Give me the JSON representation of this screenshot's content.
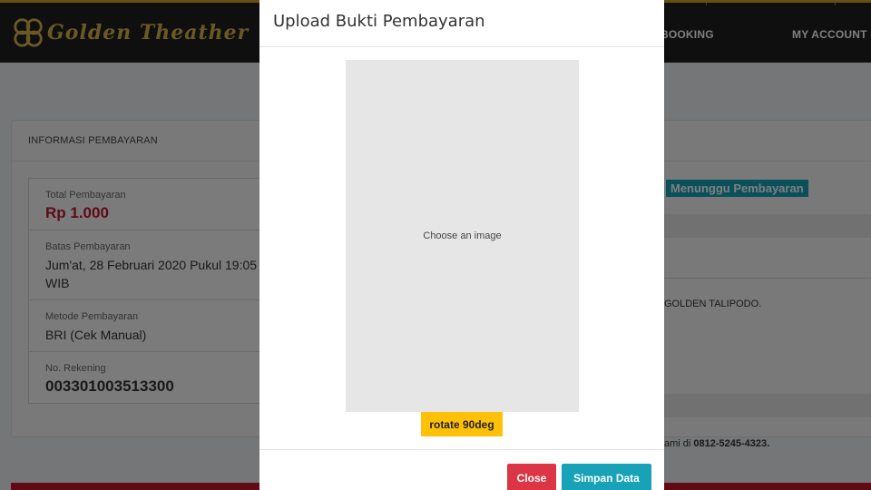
{
  "header": {
    "brand": "Golden Theather",
    "nav": [
      {
        "label": "BOOKING"
      },
      {
        "label": "MY ACCOUNT ("
      }
    ]
  },
  "page": {
    "section_title": "INFORMASI PEMBAYARAN",
    "rows": [
      {
        "label": "Total Pembayaran",
        "value": "Rp 1.000"
      },
      {
        "label": "Batas Pembayaran",
        "value": "Jum'at, 28 Februari 2020 Pukul 19:05 WIB"
      },
      {
        "label": "Metode Pembayaran",
        "value": "BRI (Cek Manual)"
      },
      {
        "label": "No. Rekening",
        "value": "003301003513300"
      }
    ],
    "status": "Menunggu Pembayaran",
    "right_text_1": "GOLDEN TALIPODO.",
    "right_text_2_prefix": "ami di ",
    "right_text_2_phone": "0812-5245-4323."
  },
  "modal": {
    "title": "Upload Bukti Pembayaran",
    "image_placeholder": "Choose an image",
    "rotate_label": "rotate 90deg",
    "close_label": "Close",
    "save_label": "Simpan Data"
  },
  "colors": {
    "gold": "#d6b24a",
    "header_bg": "#1e1e1e",
    "danger": "#dc3545",
    "info": "#17a2b8",
    "warning": "#ffc107",
    "price_red": "#c0152f"
  }
}
